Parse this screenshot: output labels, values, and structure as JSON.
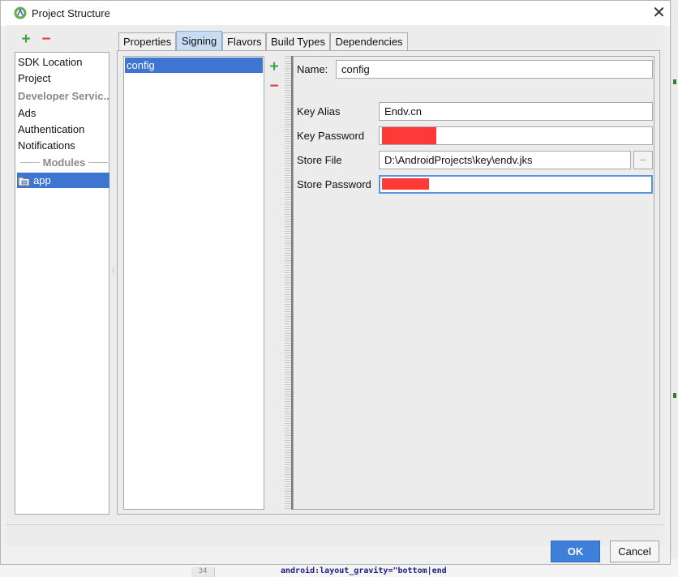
{
  "window": {
    "title": "Project Structure"
  },
  "sidebar": {
    "items": [
      {
        "label": "SDK Location",
        "kind": "item"
      },
      {
        "label": "Project",
        "kind": "item"
      },
      {
        "label": "Developer Servic...",
        "kind": "section"
      },
      {
        "label": "Ads",
        "kind": "item"
      },
      {
        "label": "Authentication",
        "kind": "item"
      },
      {
        "label": "Notifications",
        "kind": "item"
      }
    ],
    "modules_label": "Modules",
    "module_selected": "app"
  },
  "tabs": [
    "Properties",
    "Signing",
    "Flavors",
    "Build Types",
    "Dependencies"
  ],
  "active_tab": "Signing",
  "signing": {
    "configs": [
      "config"
    ],
    "selected_config": "config",
    "form": {
      "name_label": "Name:",
      "name_value": "config",
      "key_alias_label": "Key Alias",
      "key_alias_value": "Endv.cn",
      "key_password_label": "Key Password",
      "store_file_label": "Store File",
      "store_file_value": "D:\\AndroidProjects\\key\\endv.jks",
      "browse_label": "...",
      "store_password_label": "Store Password"
    }
  },
  "footer": {
    "ok_label": "OK",
    "cancel_label": "Cancel"
  },
  "background": {
    "code_snippet": "android:layout_gravity=\"bottom|end",
    "gutter_line": "34"
  },
  "colors": {
    "selection": "#3d75d0",
    "ok_button": "#3d7fd9",
    "redaction": "#ff3838",
    "add": "#3aa53a",
    "remove": "#e04040"
  }
}
